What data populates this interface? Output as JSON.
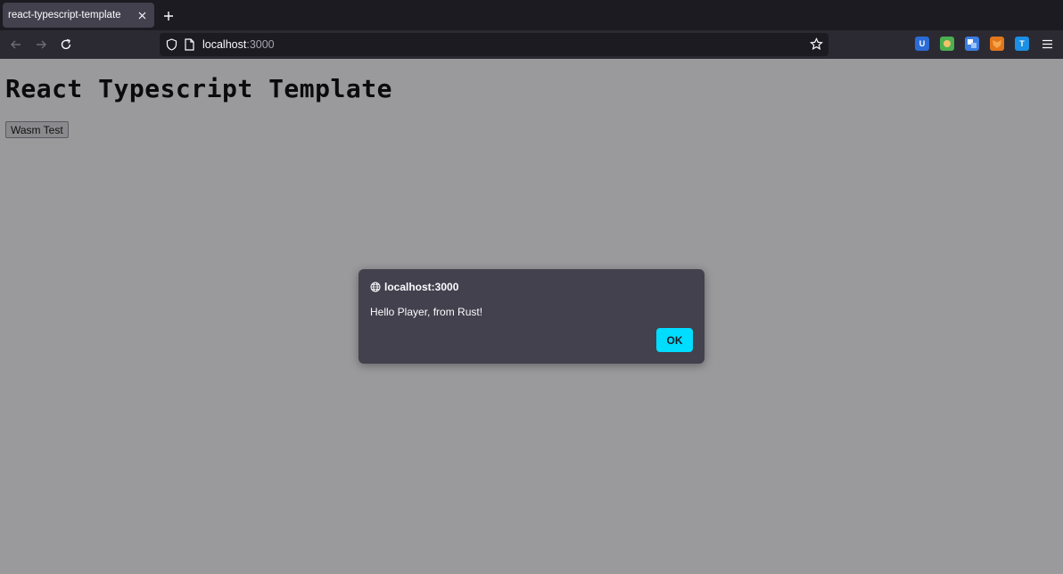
{
  "browser": {
    "tab": {
      "title": "react-typescript-template"
    },
    "address": {
      "host": "localhost",
      "port": ":3000"
    },
    "extensions": [
      {
        "name": "ublock-icon",
        "badge": "U",
        "color": "#2b6bd6"
      },
      {
        "name": "extension-shield-icon",
        "badge": "",
        "color": "#4caf50"
      },
      {
        "name": "translate-icon",
        "badge": "",
        "color": "#3b7de0"
      },
      {
        "name": "metamask-fox-icon",
        "badge": "",
        "color": "#e2761b"
      },
      {
        "name": "t-extension-icon",
        "badge": "T",
        "color": "#1a8fe3"
      }
    ]
  },
  "page": {
    "heading": "React Typescript Template",
    "button_label": "Wasm Test"
  },
  "dialog": {
    "origin": "localhost:3000",
    "message": "Hello Player, from Rust!",
    "ok_label": "OK"
  },
  "colors": {
    "accent": "#00ddff",
    "page_bg": "#9a9a9d",
    "dialog_bg": "#42414d"
  }
}
